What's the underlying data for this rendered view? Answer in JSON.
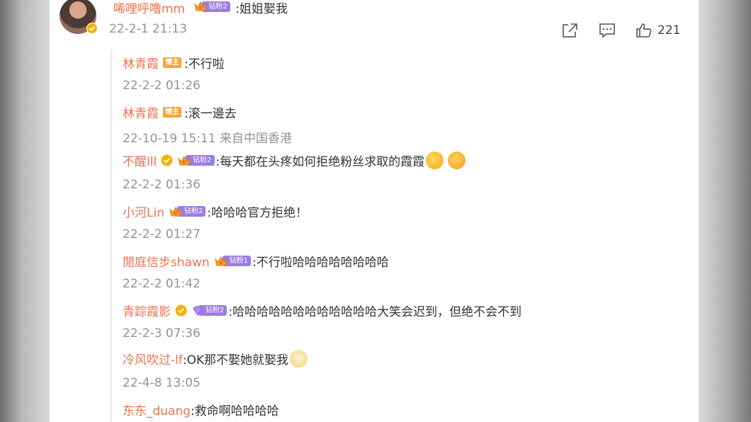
{
  "comment": {
    "user": "唏哩呼噜mm",
    "fan_badge": "钻粉2",
    "text": ":姐姐娶我",
    "time": "22-2-1 21:13",
    "like_count": "221",
    "icons": [
      "share-icon",
      "comment-icon",
      "like-icon"
    ]
  },
  "replies": [
    {
      "user": "林青霞",
      "badge": "博主",
      "text": ":不行啦",
      "time": "22-2-2 01:26"
    },
    {
      "user": "林青霞",
      "badge": "博主",
      "text": ":滚一邊去",
      "time": "22-10-19 15:11 来自中国香港"
    },
    {
      "user": "不醒lll",
      "fan_badge": "钻粉2",
      "text": ":每天都在头疼如何拒绝粉丝求取的霞霞",
      "time": "22-2-2 01:36"
    },
    {
      "user": "小河Lin",
      "fan_badge": "钻粉2",
      "text": ":哈哈哈官方拒绝！",
      "time": "22-2-2 01:27"
    },
    {
      "user": "閒庭信步shawn",
      "fan_badge": "钻粉1",
      "text": ":不行啦哈哈哈哈哈哈哈哈",
      "time": "22-2-2 01:42"
    },
    {
      "user": "青踪霞影",
      "fan_badge": "钻粉2",
      "text": ":哈哈哈哈哈哈哈哈哈哈哈哈大笑会迟到，但绝不会不到",
      "time": "22-2-3 07:36"
    },
    {
      "user": "冷风吹过-lf",
      "text": ":OK那不娶她就娶我",
      "time": "22-4-8 13:05"
    },
    {
      "user": "东东_duang",
      "text": ":救命啊哈哈哈哈"
    }
  ],
  "colors": {
    "username": "#eb7350",
    "time": "#939393",
    "text": "#333333",
    "host_badge": "#ffa332",
    "fan_badge": "#9d7ce2",
    "verified": "#f5b100"
  }
}
